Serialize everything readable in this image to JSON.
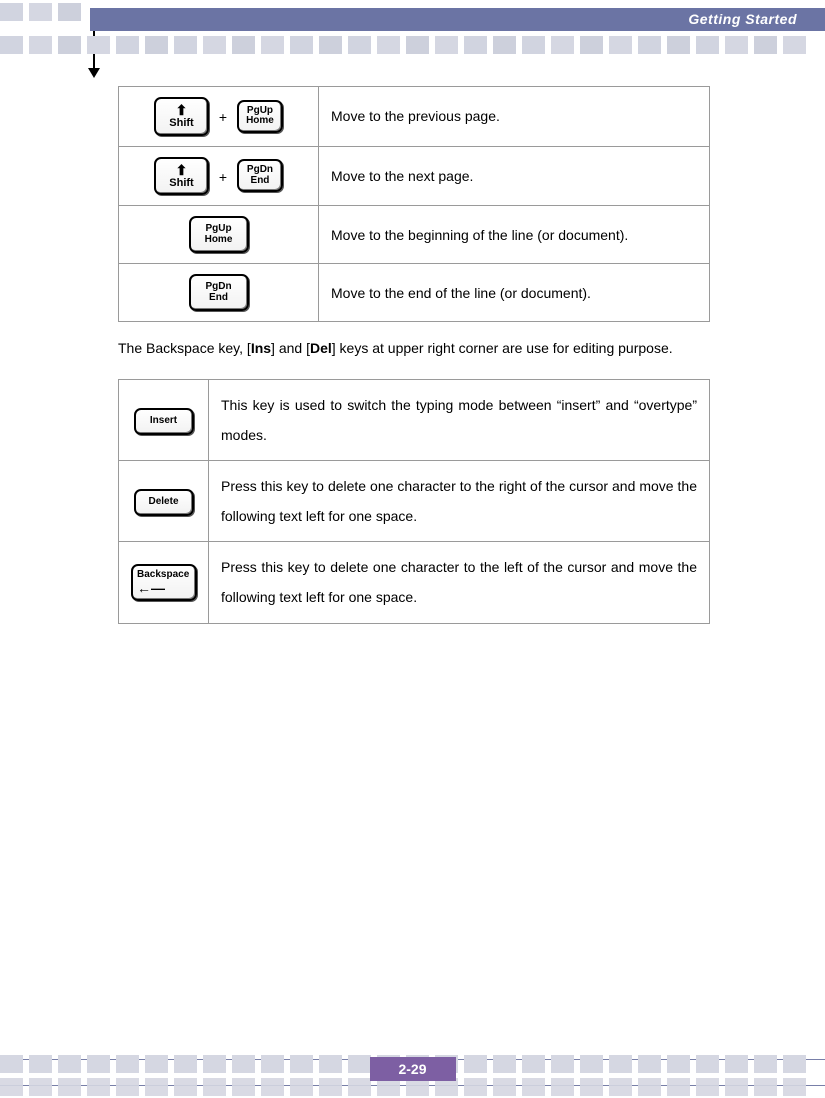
{
  "header": {
    "title": "Getting Started"
  },
  "nav_table": {
    "rows": [
      {
        "keys": {
          "k1_arrow": "⬆",
          "k1_label": "Shift",
          "plus": "+",
          "k2_l1": "PgUp",
          "k2_l2": "Home"
        },
        "desc": "Move to the previous page."
      },
      {
        "keys": {
          "k1_arrow": "⬆",
          "k1_label": "Shift",
          "plus": "+",
          "k2_l1": "PgDn",
          "k2_l2": "End"
        },
        "desc": "Move to the next page."
      },
      {
        "keys": {
          "k_l1": "PgUp",
          "k_l2": "Home"
        },
        "desc": "Move to the beginning of the line (or document)."
      },
      {
        "keys": {
          "k_l1": "PgDn",
          "k_l2": "End"
        },
        "desc": "Move to the end of the line (or document)."
      }
    ]
  },
  "paragraph": {
    "t1": "The Backspace key, [",
    "b1": "Ins",
    "t2": "] and [",
    "b2": "Del",
    "t3": "] keys at upper right corner are use for editing purpose."
  },
  "edit_table": {
    "rows": [
      {
        "key_label": "Insert",
        "desc": "This key is used to switch the typing mode between “insert” and “overtype” modes."
      },
      {
        "key_label": "Delete",
        "desc": "Press this key to delete one character to the right of the cursor and move the following text left for one space."
      },
      {
        "key_top": "Backspace",
        "key_arrow": "←—",
        "desc": "Press this key to delete one character to the left of the cursor and move the following text left for one space."
      }
    ]
  },
  "footer": {
    "page_number": "2-29"
  }
}
